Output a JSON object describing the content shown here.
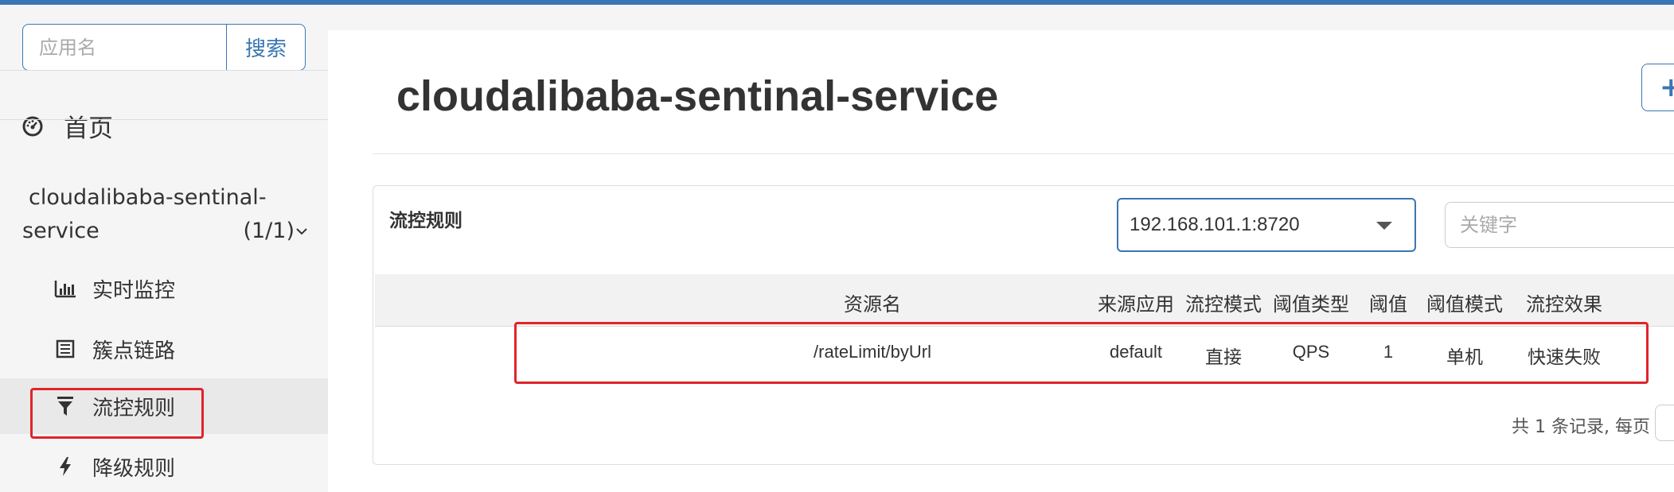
{
  "sidebar": {
    "search": {
      "placeholder": "应用名",
      "button_label": "搜索"
    },
    "home": {
      "label": "首页",
      "icon": "dashboard-icon"
    },
    "app": {
      "name_line1": "cloudalibaba-sentinal-",
      "name_line2": "service",
      "count": "(1/1)"
    },
    "items": [
      {
        "label": "实时监控",
        "icon": "bar-chart-icon"
      },
      {
        "label": "簇点链路",
        "icon": "list-icon"
      },
      {
        "label": "流控规则",
        "icon": "filter-icon",
        "active": true
      },
      {
        "label": "降级规则",
        "icon": "flash-icon"
      }
    ]
  },
  "main": {
    "title": "cloudalibaba-sentinal-service",
    "add_button_label": "+",
    "panel": {
      "title": "流控规则",
      "machine_select": "192.168.101.1:8720",
      "keyword_placeholder": "关键字",
      "columns": [
        "资源名",
        "来源应用",
        "流控模式",
        "阈值类型",
        "阈值",
        "阈值模式",
        "流控效果"
      ],
      "rows": [
        [
          "/rateLimit/byUrl",
          "default",
          "直接",
          "QPS",
          "1",
          "单机",
          "快速失败"
        ]
      ],
      "pagination_text": "共 1 条记录, 每页"
    }
  },
  "colors": {
    "accent": "#3a76b3",
    "highlight": "#e0242b"
  }
}
